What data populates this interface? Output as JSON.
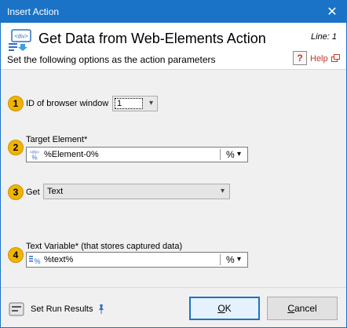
{
  "window": {
    "title": "Insert Action",
    "close_glyph": "✕"
  },
  "header": {
    "action_title": "Get Data from Web-Elements Action",
    "line_label": "Line: 1",
    "subtitle": "Set the following options as the action parameters",
    "help_label": "Help",
    "help_glyph": "?"
  },
  "steps": [
    {
      "number": "1",
      "label": "ID of browser window",
      "value": "1"
    },
    {
      "number": "2",
      "label": "Target Element*",
      "value": "%Element-0%",
      "var_button": "%"
    },
    {
      "number": "3",
      "label": "Get",
      "value": "Text"
    },
    {
      "number": "4",
      "label": "Text Variable* (that stores captured data)",
      "value": "%text%",
      "var_button": "%"
    }
  ],
  "footer": {
    "run_results_label": "Set Run Results",
    "ok_label": "OK",
    "ok_mnemonic_rest": "K",
    "ok_mnemonic": "O",
    "cancel_mnemonic": "C",
    "cancel_rest": "ancel"
  },
  "colors": {
    "accent": "#1a73c7",
    "badge": "#f0b400",
    "help": "#c0392b"
  },
  "icons": [
    "div-element-icon",
    "close-icon",
    "help-icon",
    "popout-icon",
    "element-icon",
    "variable-icon",
    "chevron-down-icon",
    "run-results-icon",
    "pin-icon"
  ]
}
